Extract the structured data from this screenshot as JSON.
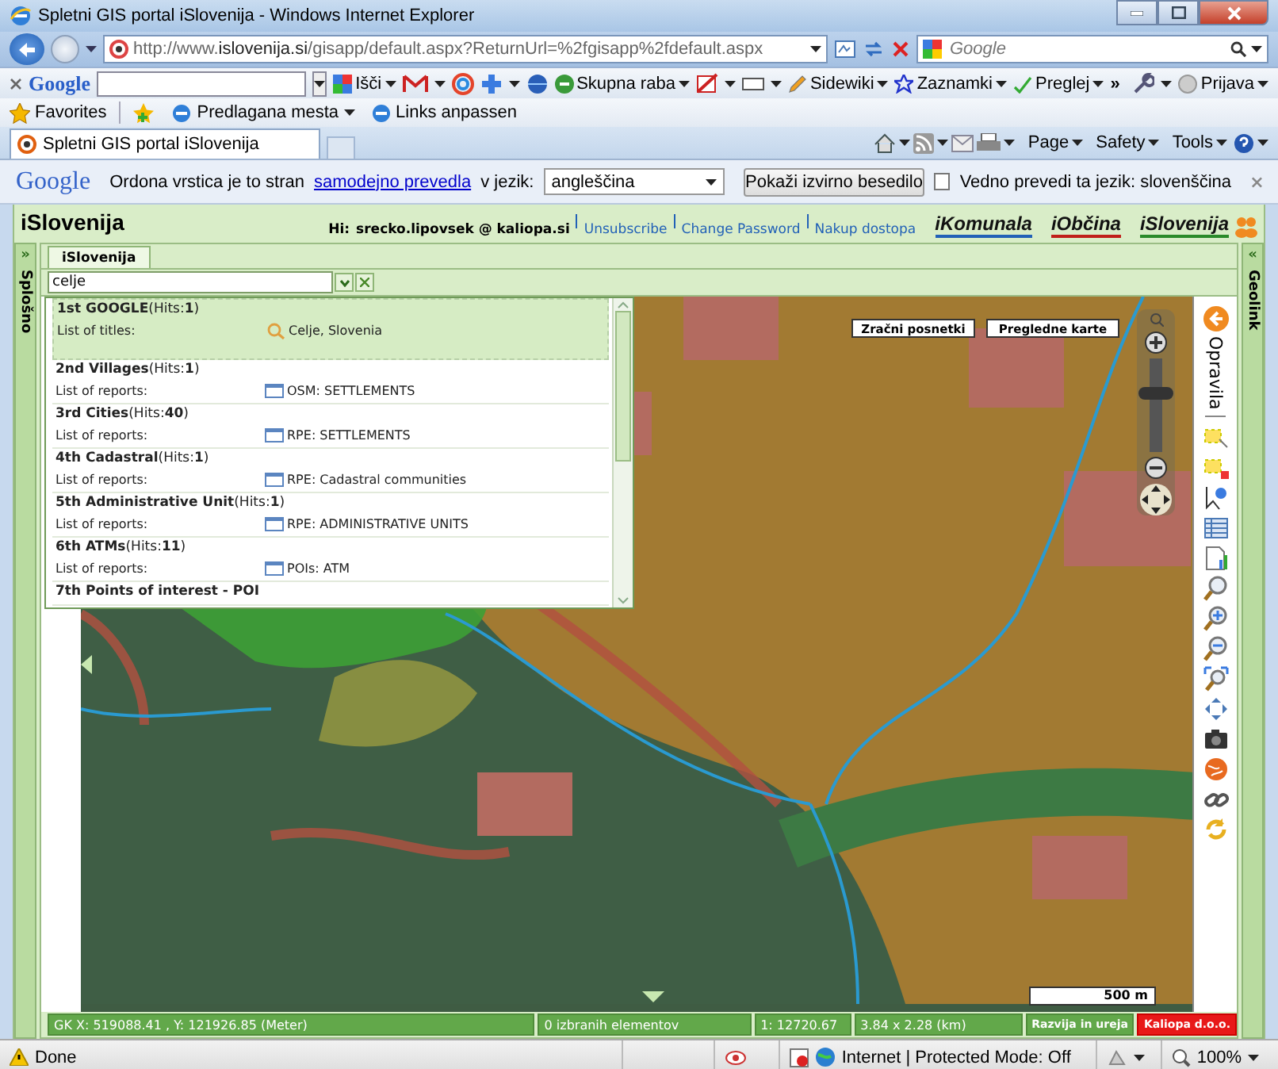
{
  "window": {
    "title": "Spletni GIS portal iSlovenija - Windows Internet Explorer"
  },
  "address_bar": {
    "url": "http://www.**islovenija.si**/gisapp/default.aspx?ReturnUrl=%2fgisapp%2fdefault.aspx"
  },
  "search_box": {
    "placeholder": "Google"
  },
  "google_toolbar": {
    "logo": "Google",
    "items": [
      {
        "label": "Išči",
        "kind": "search"
      },
      {
        "label": "Skupna raba",
        "kind": "share"
      },
      {
        "label": "Sidewiki",
        "kind": "wiki"
      },
      {
        "label": "Zaznamki",
        "kind": "star"
      },
      {
        "label": "Preglej",
        "kind": "spell"
      }
    ],
    "more": "»",
    "sign_in": "Prijava"
  },
  "favorites_bar": {
    "favorites": "Favorites",
    "items": [
      "Predlagana mesta",
      "Links anpassen"
    ]
  },
  "tabs": [
    {
      "label": "Spletni GIS portal iSlovenija",
      "selected": true
    }
  ],
  "command_bar": [
    "Page",
    "Safety",
    "Tools"
  ],
  "translate_bar": {
    "logo": "Google",
    "text": "Ordona vrstica je to stran",
    "link": "samodejno prevedla",
    "text_after": "v jezik:",
    "language": "angleščina",
    "button": "Pokaži izvirno besedilo",
    "always_label": "Vedno prevedi ta jezik: slovenščina",
    "always_checked": false
  },
  "app": {
    "title": "iSlovenija",
    "greeting": "Hi:",
    "user": "srecko.lipovsek @ kaliopa.si",
    "links": [
      "Unsubscribe",
      "Change Password",
      "Nakup dostopa"
    ],
    "brands": [
      "iKomunala",
      "iObčina",
      "iSlovenija"
    ]
  },
  "left_panel": {
    "toggle": "»",
    "label": "Splošno"
  },
  "right_panel": {
    "toggle": "«",
    "label": "Geolink"
  },
  "map_tabs": [
    {
      "label": "iSlovenija",
      "selected": true
    }
  ],
  "search": {
    "value": "celje"
  },
  "results": [
    {
      "heading": "**1st GOOGLE**(Hits:**1**)",
      "list_label": "List of titles:",
      "entry": "Celje, Slovenia",
      "kind": "google",
      "selected": true
    },
    {
      "heading": "**2nd Villages**(Hits:**1**)",
      "list_label": "List of reports:",
      "entry": "OSM: SETTLEMENTS",
      "kind": "report",
      "selected": false
    },
    {
      "heading": "**3rd Cities**(Hits:**40**)",
      "list_label": "List of reports:",
      "entry": "RPE: SETTLEMENTS",
      "kind": "report",
      "selected": false
    },
    {
      "heading": "**4th Cadastral**(Hits:**1**)",
      "list_label": "List of reports:",
      "entry": "RPE: Cadastral communities",
      "kind": "report",
      "selected": false
    },
    {
      "heading": "**5th Administrative Unit**(Hits:**1**)",
      "list_label": "List of reports:",
      "entry": "RPE: ADMINISTRATIVE UNITS",
      "kind": "report",
      "selected": false
    },
    {
      "heading": "**6th ATMs**(Hits:**11**)",
      "list_label": "List of reports:",
      "entry": "POIs: ATM",
      "kind": "report",
      "selected": false
    },
    {
      "heading": "**7th Points of interest - POI**",
      "kind": "heading_only",
      "selected": false
    }
  ],
  "map_buttons": [
    "Zračni posnetki",
    "Pregledne karte"
  ],
  "zoom_slider": {
    "level": 0.65
  },
  "tools_panel": {
    "label": "Opravila"
  },
  "scale": "500 m",
  "status": {
    "coords": "GK X: 519088.41 , Y: 121926.85 (Meter)",
    "selected": "0 izbranih elementov",
    "scale": "1: 12720.67",
    "extent": "3.84 x 2.28 (km)",
    "credit": "Razvija in ureja",
    "company": "Kaliopa d.o.o."
  },
  "ie_status": {
    "text": "Done",
    "zone": "Internet | Protected Mode: Off",
    "zoom": "100%"
  }
}
